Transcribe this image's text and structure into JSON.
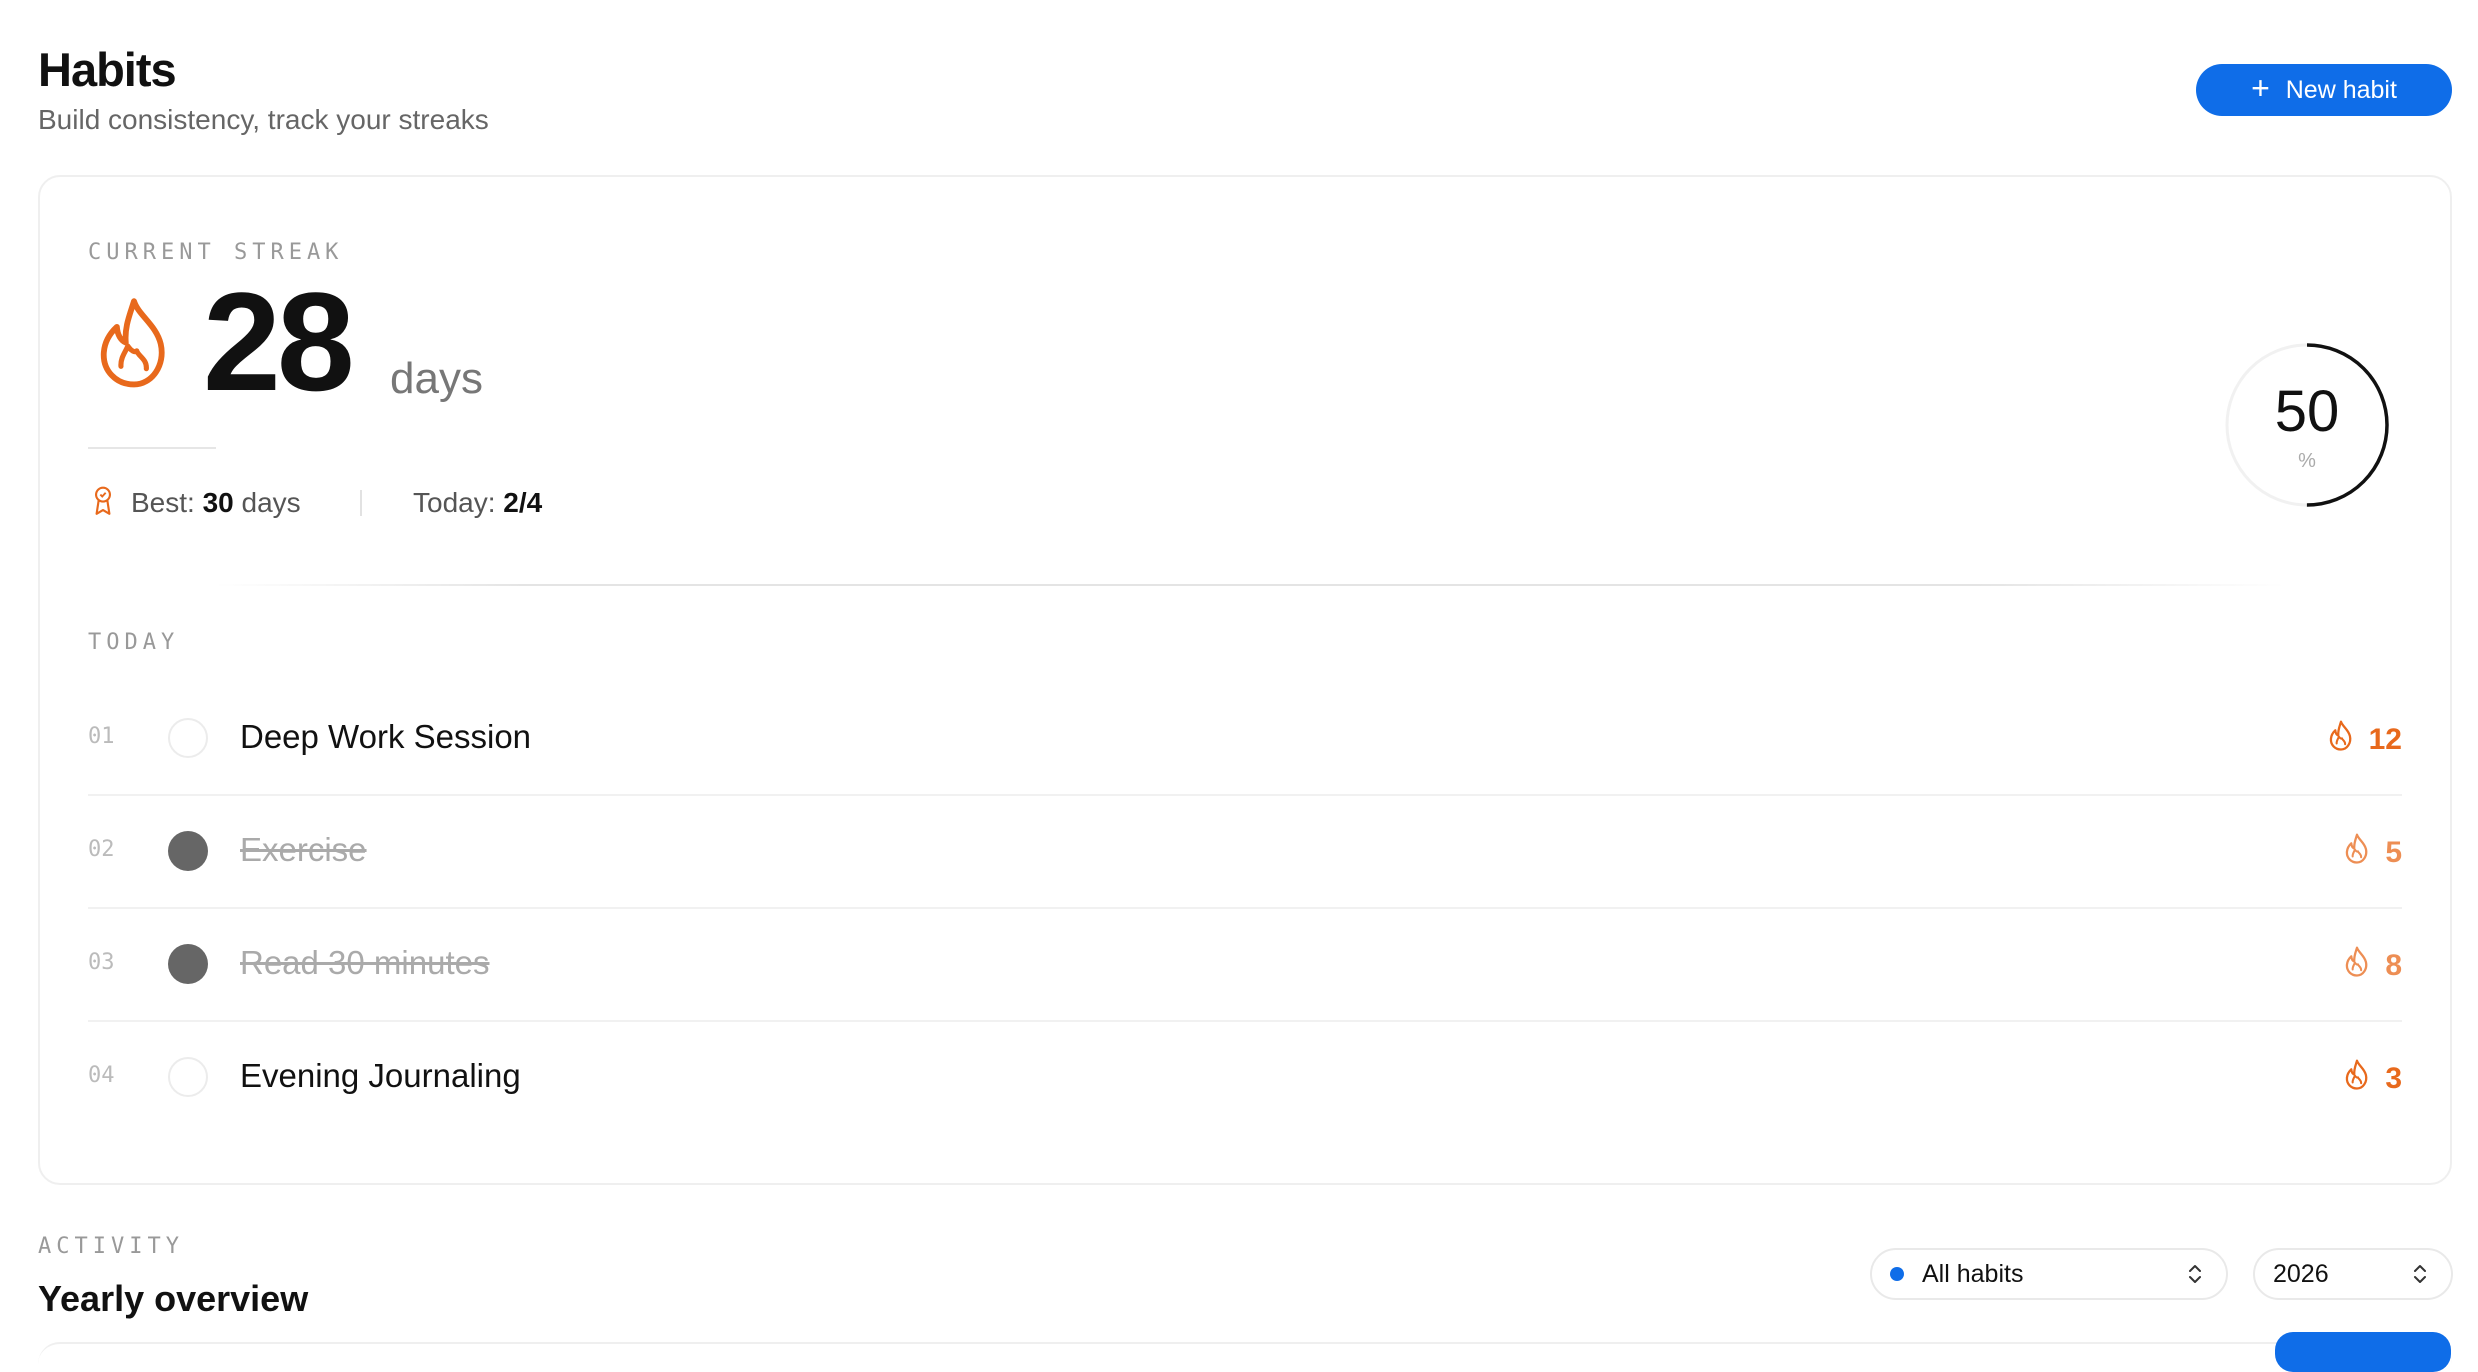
{
  "header": {
    "title": "Habits",
    "subtitle": "Build consistency, track your streaks",
    "new_habit_label": "New habit"
  },
  "streak": {
    "section_label": "CURRENT STREAK",
    "value": "28",
    "unit": "days",
    "best_label": "Best:",
    "best_value": "30",
    "best_unit": "days",
    "today_label": "Today:",
    "today_value": "2/4",
    "completion_percent": "50",
    "completion_unit": "%"
  },
  "today": {
    "section_label": "TODAY",
    "habits": [
      {
        "number": "01",
        "name": "Deep Work Session",
        "completed": false,
        "streak": "12"
      },
      {
        "number": "02",
        "name": "Exercise",
        "completed": true,
        "streak": "5"
      },
      {
        "number": "03",
        "name": "Read 30 minutes",
        "completed": true,
        "streak": "8"
      },
      {
        "number": "04",
        "name": "Evening Journaling",
        "completed": false,
        "streak": "3"
      }
    ]
  },
  "activity": {
    "section_label": "ACTIVITY",
    "title": "Yearly overview",
    "habit_filter": "All habits",
    "year_filter": "2026"
  },
  "colors": {
    "accent": "#0f6de8",
    "flame": "#e8691c",
    "completed_check": "#666666"
  },
  "icons": {
    "new_habit": "plus-icon",
    "streak": "flame-icon",
    "best": "trophy-icon",
    "select": "chevron-up-down-icon"
  }
}
